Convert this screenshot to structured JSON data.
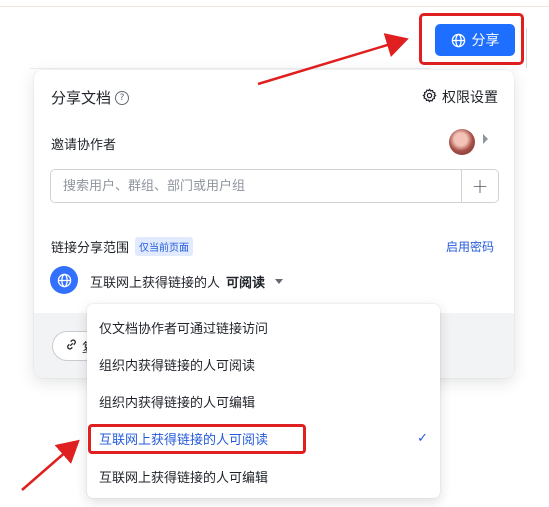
{
  "toolbar": {
    "share_label": "分享"
  },
  "panel": {
    "title": "分享文档",
    "help_glyph": "?",
    "permission_settings": "权限设置",
    "invite_label": "邀请协作者",
    "search_placeholder": "搜索用户、群组、部门或用户组",
    "add_glyph": "+",
    "link_scope_label": "链接分享范围",
    "scope_badge": "仅当前页面",
    "enable_password": "启用密码",
    "scope_value_prefix": "互联网上获得链接的人",
    "scope_value_emphasis": "可阅读",
    "copy_link_partial": "复"
  },
  "dropdown": {
    "items": [
      {
        "label": "仅文档协作者可通过链接访问"
      },
      {
        "label": "组织内获得链接的人可阅读"
      },
      {
        "label": "组织内获得链接的人可编辑"
      },
      {
        "label": "互联网上获得链接的人可阅读"
      },
      {
        "label": "互联网上获得链接的人可编辑"
      }
    ],
    "selected_check": "✓"
  },
  "icons": {
    "share_button": "globe-icon",
    "help": "question-circle-icon",
    "settings": "gear-icon",
    "avatar_caret": "caret-right-icon",
    "scope_globe": "globe-icon",
    "select_caret": "caret-down-icon",
    "copy_link": "link-icon",
    "selected": "check-icon"
  },
  "colors": {
    "primary": "#1e6fff",
    "link_blue": "#245bdb",
    "annotation_red": "#e02020",
    "badge_bg": "#e1eaff"
  }
}
